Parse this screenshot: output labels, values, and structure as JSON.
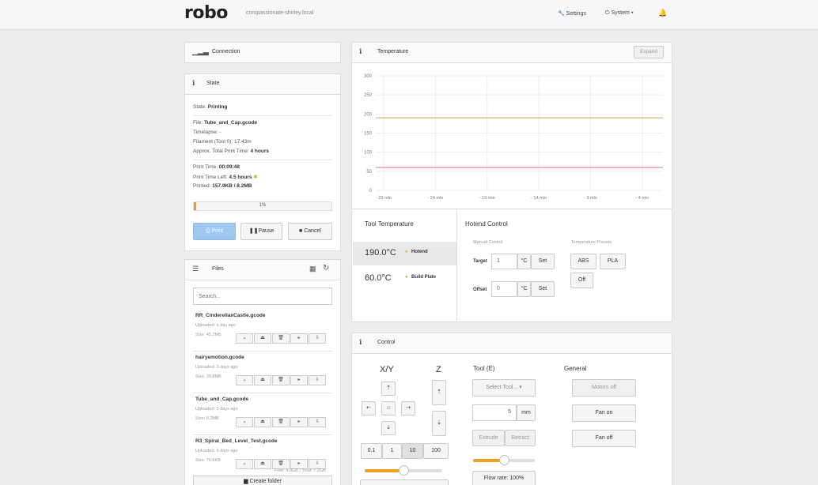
{
  "header": {
    "logo": "robo",
    "hostname": "compassionate-shirley.local",
    "settings": "Settings",
    "system": "System",
    "system_caret": "▾"
  },
  "connection": {
    "title": "Connection"
  },
  "state": {
    "title": "State",
    "state_label": "State:",
    "state_value": "Printing",
    "file_label": "File:",
    "file_value": "Tube_and_Cap.gcode",
    "timelapse_label": "Timelapse:",
    "timelapse_value": "-",
    "filament_label": "Filament (Tool 0):",
    "filament_value": "17.43m",
    "approx_label": "Approx. Total Print Time:",
    "approx_value": "4 hours",
    "printtime_label": "Print Time:",
    "printtime_value": "00:09:48",
    "timeleft_label": "Print Time Left:",
    "timeleft_value": "4.5 hours",
    "printed_label": "Printed:",
    "printed_value": "157.9KB / 8.2MB",
    "progress_pct": 1,
    "progress_text": "1%",
    "buttons": {
      "print": "Print",
      "pause": "Pause",
      "cancel": "Cancel"
    }
  },
  "files": {
    "title": "Files",
    "search_placeholder": "Search...",
    "items": [
      {
        "name": "RR_CinderellaxCastle.gcode",
        "uploaded": "Uploaded: a day ago",
        "size": "Size: 45.2MB"
      },
      {
        "name": "hairyemotion.gcode",
        "uploaded": "Uploaded: 3 days ago",
        "size": "Size: 39.8MB"
      },
      {
        "name": "Tube_and_Cap.gcode",
        "uploaded": "Uploaded: 5 days ago",
        "size": "Size: 8.2MB"
      },
      {
        "name": "R3_Spiral_Bed_Level_Test.gcode",
        "uploaded": "Uploaded: 6 days ago",
        "size": "Size: 70.6KB"
      }
    ],
    "free": "Free: 4.8GB / Total: 7.2GB",
    "create_folder": "Create folder"
  },
  "temperature": {
    "title": "Temperature",
    "expand": "Expand",
    "chart_data": {
      "type": "line",
      "categories": [
        "- 29 min",
        "- 24 min",
        "- 19 min",
        "- 14 min",
        "- 9 min",
        "- 4 min"
      ],
      "yticks": [
        0,
        50,
        100,
        150,
        200,
        250,
        300
      ],
      "ylim": [
        0,
        300
      ],
      "series": [
        {
          "values": [
            190,
            190,
            190,
            190,
            190,
            190
          ],
          "color": "#e8a860"
        },
        {
          "values": [
            60,
            60,
            60,
            60,
            60,
            60
          ],
          "color": "#ee8888"
        }
      ]
    },
    "tool_temp_title": "Tool Temperature",
    "hotend_temp": "190.0°C",
    "hotend_label": "Hotend",
    "bed_temp": "60.0°C",
    "bed_label": "Build Plate",
    "hotend_control_title": "Hotend Control",
    "manual_control": "Manual Control",
    "temp_presets": "Temperature Presets",
    "target_label": "Target",
    "target_value": "1",
    "unit": "°C",
    "set": "Set",
    "offset_label": "Offset",
    "offset_value": "0",
    "preset_abs": "ABS",
    "preset_pla": "PLA",
    "preset_off": "Off"
  },
  "control": {
    "title": "Control",
    "xy": "X/Y",
    "z": "Z",
    "steps": [
      "0.1",
      "1",
      "10",
      "100"
    ],
    "tool": "Tool (E)",
    "select_tool": "Select Tool...",
    "extrude_amount": "5",
    "mm": "mm",
    "extrude": "Extrude",
    "retract": "Retract",
    "flow_rate": "Flow rate: 100%",
    "general": "General",
    "motors_off": "Motors off",
    "fan_on": "Fan on",
    "fan_off": "Fan off"
  },
  "colors": {
    "accent": "#f0a020",
    "primary_btn": "#9ec8ee",
    "hotend_line": "#e8a860",
    "bed_line": "#ee8888"
  }
}
